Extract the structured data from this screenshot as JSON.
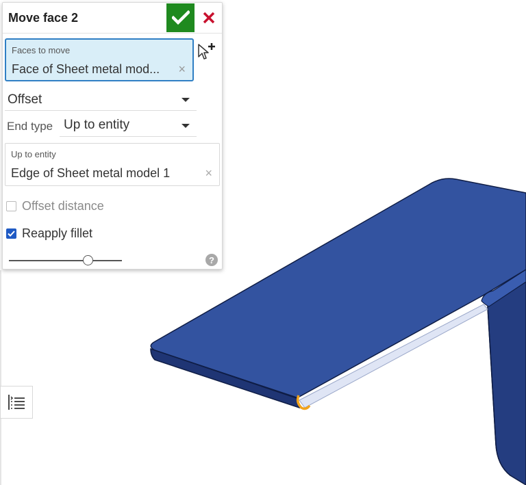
{
  "dialog": {
    "title": "Move face 2",
    "faces_to_move": {
      "label": "Faces to move",
      "value": "Face of Sheet metal mod...",
      "clear": "×"
    },
    "move_type": {
      "value": "Offset"
    },
    "end_type": {
      "label": "End type",
      "value": "Up to entity"
    },
    "up_to_entity": {
      "label": "Up to entity",
      "value": "Edge of Sheet metal model 1",
      "clear": "×"
    },
    "offset_distance": {
      "label": "Offset distance",
      "checked": false
    },
    "reapply_fillet": {
      "label": "Reapply fillet",
      "checked": true
    },
    "slider_level": 0.7,
    "help": "?"
  },
  "colors": {
    "accept": "#1f8a1f",
    "cancel": "#c8102e",
    "selection_fill": "#d9eef8",
    "selection_border": "#2f7fc4",
    "part_top": "#3353a0",
    "part_edge": "#1c2f66",
    "highlight": "#f2a31b"
  },
  "icons": {
    "accept": "checkmark-icon",
    "cancel": "close-icon",
    "add_selection": "cursor-plus-icon",
    "help": "help-icon",
    "feature_list": "list-icon"
  }
}
